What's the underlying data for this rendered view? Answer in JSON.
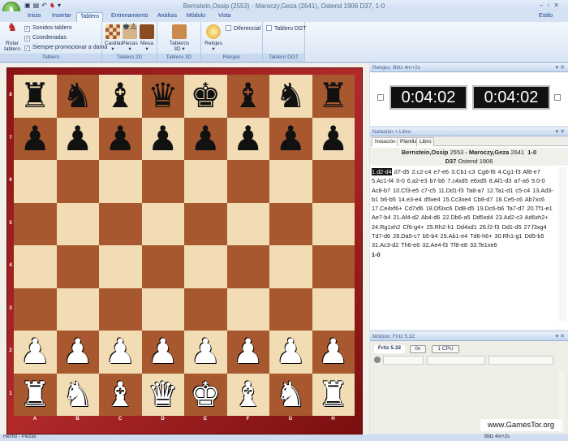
{
  "window": {
    "title": "Bernstein,Ossip (2553) - Maroczy,Geza (2641), Ostend 1906  D37, 1-0",
    "style_label": "Estilo"
  },
  "tabs": [
    "Inicio",
    "Insertar",
    "Tablero",
    "Entrenamiento",
    "Análisis",
    "Módulo",
    "Vista"
  ],
  "active_tab": 2,
  "ribbon": {
    "rotate": "Rotar tablero",
    "checks": [
      "Sonidos tablero",
      "Coordenadas",
      "Siempre promocionar a dama"
    ],
    "group_tablero": "Tablero",
    "casillas": "Casillas",
    "piezas": "Piezas",
    "mesa": "Mesa",
    "group_2d": "Tablero 2D",
    "tableros3d": "Tableros 3D",
    "group_3d": "Tablero 3D",
    "relojes": "Relojes",
    "diferencial": "Diferencial",
    "group_relojes": "Relojes",
    "dgt": "Tablero DGT",
    "group_dgt": "Tablero DGT"
  },
  "board": {
    "ranks": [
      "8",
      "7",
      "6",
      "5",
      "4",
      "3",
      "2",
      "1"
    ],
    "files": [
      "A",
      "B",
      "C",
      "D",
      "E",
      "F",
      "G",
      "H"
    ],
    "position": [
      "rnbqkbnr",
      "pppppppp",
      "........",
      "........",
      "........",
      "........",
      "PPPPPPPP",
      "RNBQKBNR"
    ],
    "colors": {
      "light": "#f1dcb4",
      "dark": "#a7582f",
      "frame": "#8b1414"
    }
  },
  "clocks": {
    "title": "Relojes: Blitz 4m+2s",
    "white": "0:04:02",
    "black": "0:04:02"
  },
  "notation": {
    "title": "Notación + Libro",
    "tabs": [
      "Notación",
      "Planilla",
      "Libro"
    ],
    "white": "Bernstein,Ossip",
    "white_elo": "2553",
    "sep": " - ",
    "black": "Maroczy,Geza",
    "black_elo": "2641",
    "result": "1-0",
    "eco": "D37",
    "event": "Ostend 1906",
    "current_move": "1.d2-d4",
    "moves": "d7-d5 2.c2-c4 e7-e6 3.Cb1-c3 Cg8-f6 4.Cg1-f3 Af8-e7 5.Ac1-f4 0-0 6.a2-e3 b7-b6 7.c4xd5 e6xd5 8.Af1-d3 a7-a6 9.0-0 Ac8-b7 10.Cf3-e5 c7-c5 11.Dd1-f3 Ta8-a7 12.Ta1-d1 c5-c4 13.Ad3-b1 b6-b5 14.e3-e4 d5xe4 15.Cc3xe4 Cb8-d7 16.Ce5-c6 Ab7xc6 17.Ce4xf6+ Cd7xf6 18.Df3xc6 Dd8-d5 19.Dc6-b6 Ta7-d7 20.Tf1-e1 Ae7-b4 21.Af4-d2 Ab4-d6 22.Db6-a5 Dd5xd4 23.Ad2-c3 Ad6xh2+ 24.Rg1xh2 Cf6-g4+ 25.Rh2-h1 Dd4xd1 26.f2-f3 Dd1-d5 27.f3xg4 Td7-d6 28.Da5-c7 b5-b4 29.Ab1-e4 Td6-h6+ 30.Rh1-g1 Dd5-b5 31.Ac3-d2 Th6-e6 32.Ae4-f3 Tf8-e8 33.Te1xe6",
    "final": "1-0"
  },
  "engine": {
    "title": "Módulo: Fritz 5.32",
    "name": "Fritz 5.32",
    "on": "0n",
    "cpu": "1 CPU"
  },
  "status": {
    "left": "Hecho - Piezas",
    "right": "Blitz 4m+2s"
  },
  "watermark": "www.GamesTor.org"
}
